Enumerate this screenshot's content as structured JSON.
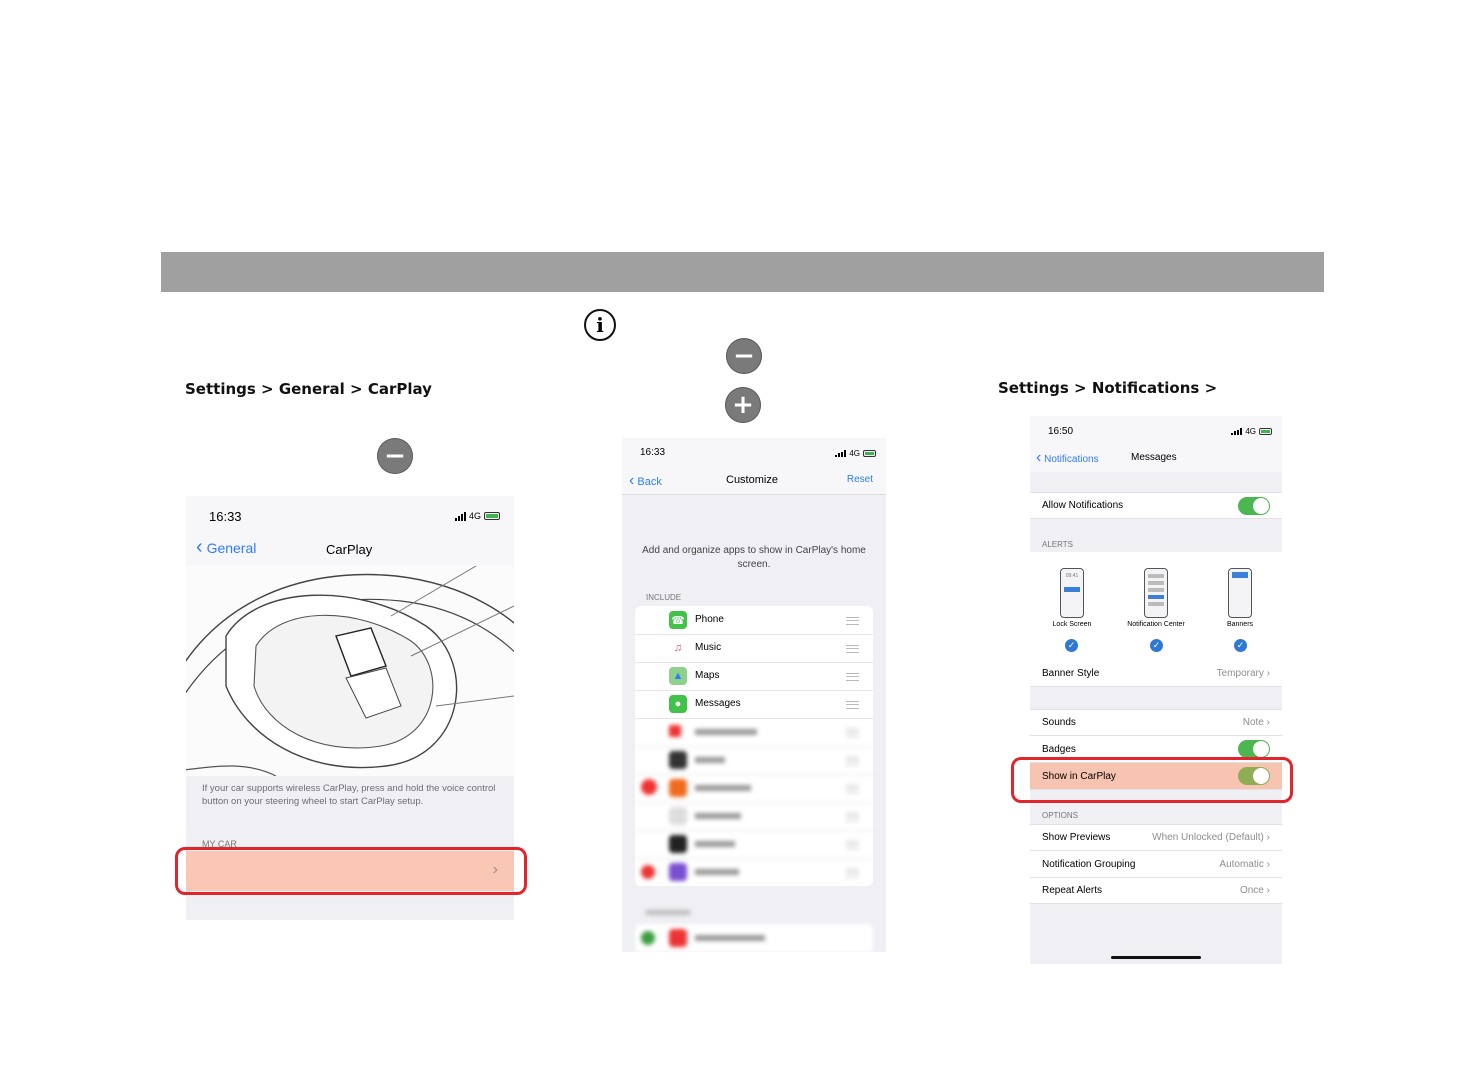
{
  "captions": {
    "carplay_path": "Settings > General > CarPlay",
    "notifications_path": "Settings > Notifications >"
  },
  "icons": {
    "info": "i",
    "minus": "−",
    "plus": "+",
    "chevron_left": "‹",
    "chevron_right": "›",
    "checkmark": "✓"
  },
  "screen1": {
    "time": "16:33",
    "network": "4G",
    "back_label": "General",
    "title": "CarPlay",
    "description": "If your car supports wireless CarPlay, press and hold the voice control button on your steering wheel to start CarPlay setup.",
    "section_my_car": "MY CAR"
  },
  "screen2": {
    "time": "16:33",
    "network": "4G",
    "back_label": "Back",
    "title": "Customize",
    "reset_label": "Reset",
    "description": "Add and organize apps to show in CarPlay's home screen.",
    "section_include": "INCLUDE",
    "apps": [
      {
        "name": "Phone",
        "color": "#43c24a",
        "glyph": "☎"
      },
      {
        "name": "Music",
        "color": "#ffffff",
        "glyph": "♫"
      },
      {
        "name": "Maps",
        "color": "#6fb6e8",
        "glyph": "▲"
      },
      {
        "name": "Messages",
        "color": "#43c24a",
        "glyph": "●"
      }
    ]
  },
  "screen3": {
    "time": "16:50",
    "network": "4G",
    "back_label": "Notifications",
    "title": "Messages",
    "allow_notifications": "Allow Notifications",
    "section_alerts": "ALERTS",
    "alert_styles": [
      "Lock Screen",
      "Notification Center",
      "Banners"
    ],
    "mini_time": "09:41",
    "banner_style_label": "Banner Style",
    "banner_style_value": "Temporary",
    "sounds_label": "Sounds",
    "sounds_value": "Note",
    "badges_label": "Badges",
    "show_in_carplay_label": "Show in CarPlay",
    "section_options": "OPTIONS",
    "show_previews_label": "Show Previews",
    "show_previews_value": "When Unlocked (Default)",
    "grouping_label": "Notification Grouping",
    "grouping_value": "Automatic",
    "repeat_label": "Repeat Alerts",
    "repeat_value": "Once",
    "toggles": {
      "allow_notifications": true,
      "badges": true,
      "show_in_carplay": true
    }
  },
  "colors": {
    "header_bar": "#a0a0a0",
    "highlight_border": "#e1252a",
    "highlight_fill": "#f7c4b1",
    "ios_blue": "#2f7cf6",
    "toggle_green": "#4cb651"
  }
}
